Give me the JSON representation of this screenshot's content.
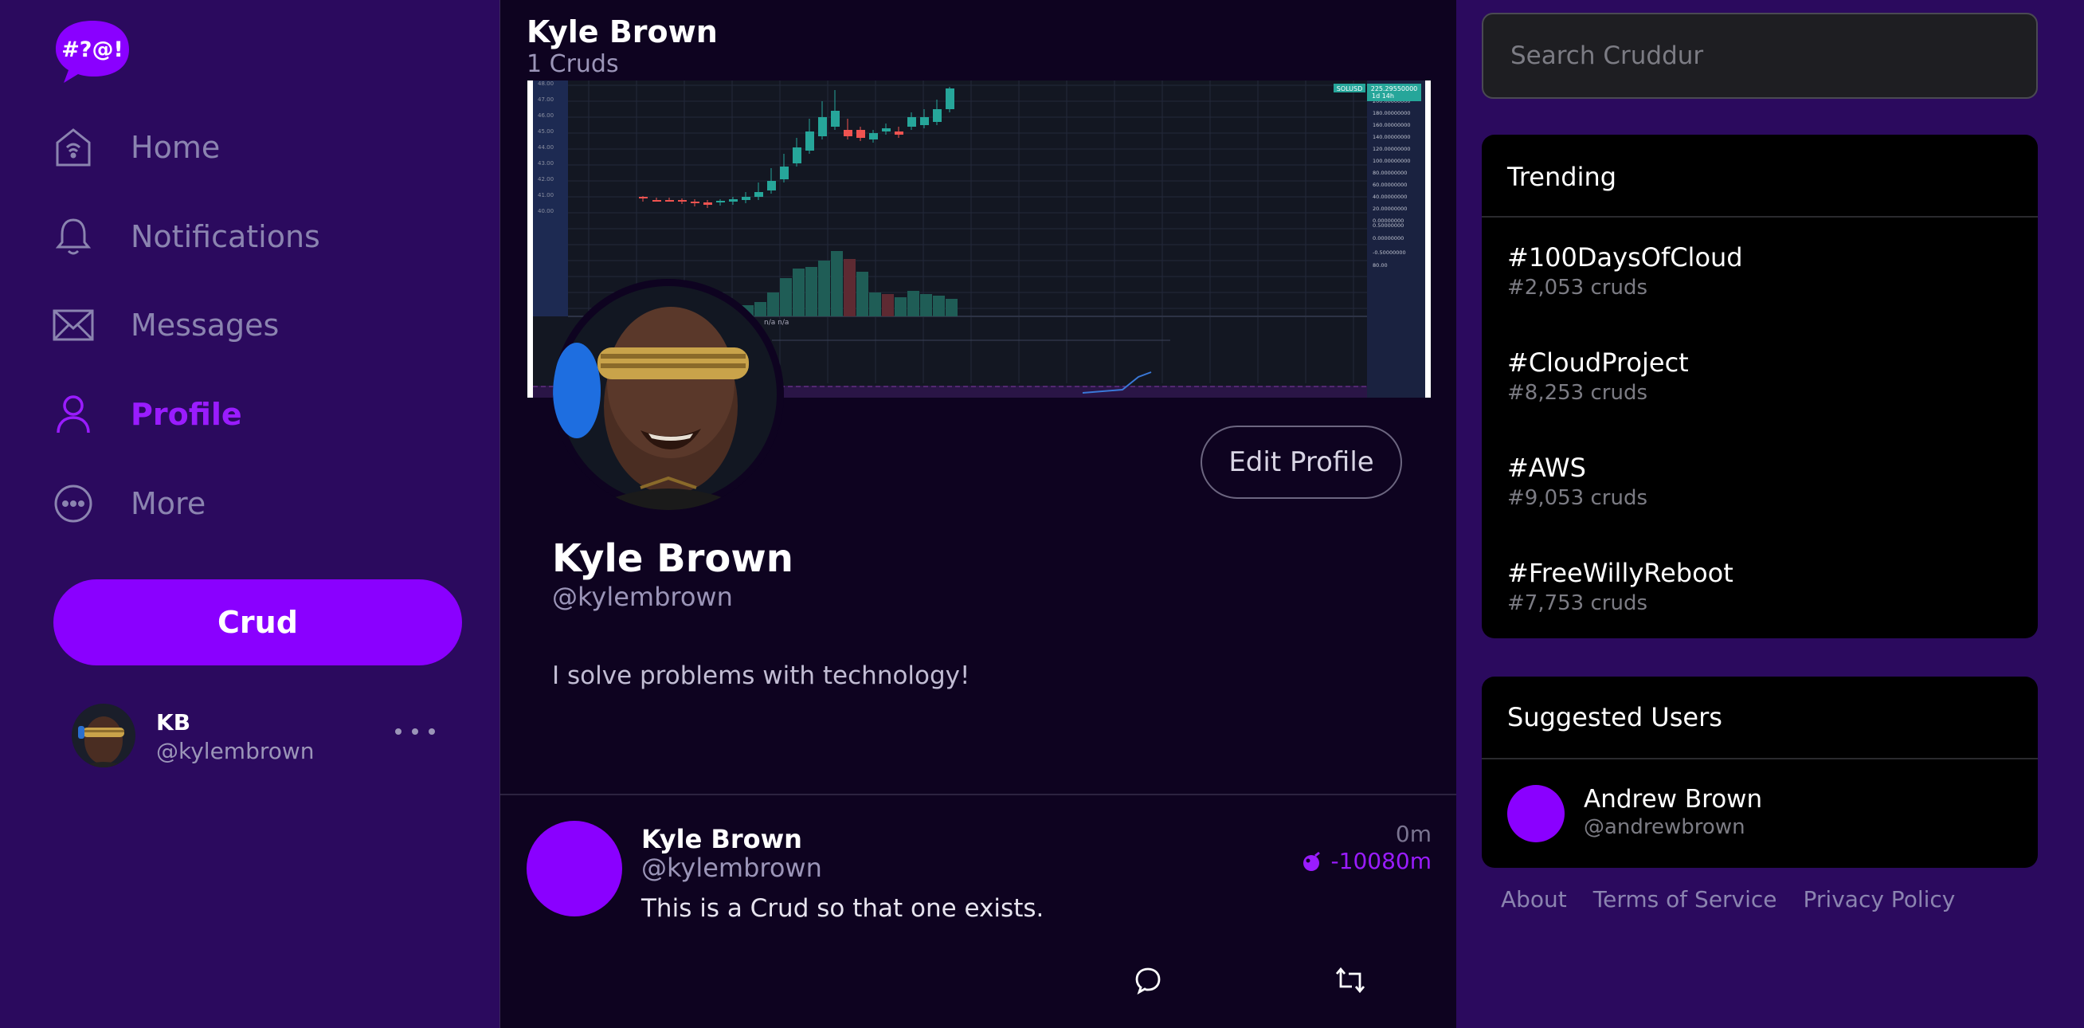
{
  "logo": {
    "text": "#?@!"
  },
  "nav": {
    "items": [
      {
        "label": "Home",
        "icon": "home-icon"
      },
      {
        "label": "Notifications",
        "icon": "bell-icon"
      },
      {
        "label": "Messages",
        "icon": "envelope-icon"
      },
      {
        "label": "Profile",
        "icon": "user-icon",
        "active": true
      },
      {
        "label": "More",
        "icon": "more-circle-icon"
      }
    ],
    "crud_button": "Crud"
  },
  "account": {
    "initials": "KB",
    "handle": "@kylembrown"
  },
  "header": {
    "name": "Kyle Brown",
    "count": "1 Cruds"
  },
  "banner": {
    "ticker": "SOLUSD",
    "price": "225.29550000",
    "tf": "1d 14h",
    "y_ticks": [
      "48.00",
      "47.00",
      "46.00",
      "45.00",
      "44.00",
      "43.00",
      "42.00",
      "41.00",
      "40.00"
    ],
    "right_ticks": [
      "200.00000000",
      "180.00000000",
      "160.00000000",
      "140.00000000",
      "120.00000000",
      "100.00000000",
      "80.00000000",
      "60.00000000",
      "40.00000000",
      "20.00000000",
      "0.00000000",
      "0.50000000",
      "0.00000000",
      "-0.50000000",
      "80.00"
    ],
    "indicator_text": "n/a n/a"
  },
  "profile": {
    "edit_button": "Edit Profile",
    "name": "Kyle Brown",
    "handle": "@kylembrown",
    "bio": "I solve problems with technology!"
  },
  "post": {
    "name": "Kyle Brown",
    "handle": "@kylembrown",
    "time": "0m",
    "ttl": "-10080m",
    "text": "This is a Crud so that one exists."
  },
  "search": {
    "placeholder": "Search Cruddur"
  },
  "trending": {
    "title": "Trending",
    "items": [
      {
        "tag": "#100DaysOfCloud",
        "count": "#2,053 cruds"
      },
      {
        "tag": "#CloudProject",
        "count": "#8,253 cruds"
      },
      {
        "tag": "#AWS",
        "count": "#9,053 cruds"
      },
      {
        "tag": "#FreeWillyReboot",
        "count": "#7,753 cruds"
      }
    ]
  },
  "suggested": {
    "title": "Suggested Users",
    "user": {
      "name": "Andrew Brown",
      "handle": "@andrewbrown"
    }
  },
  "footer": {
    "about": "About",
    "terms": "Terms of Service",
    "privacy": "Privacy Policy"
  },
  "colors": {
    "accent": "#8a00ff",
    "sidebar_bg": "#2b0a5e",
    "feed_bg": "#0e0320",
    "card_bg": "#000000"
  }
}
